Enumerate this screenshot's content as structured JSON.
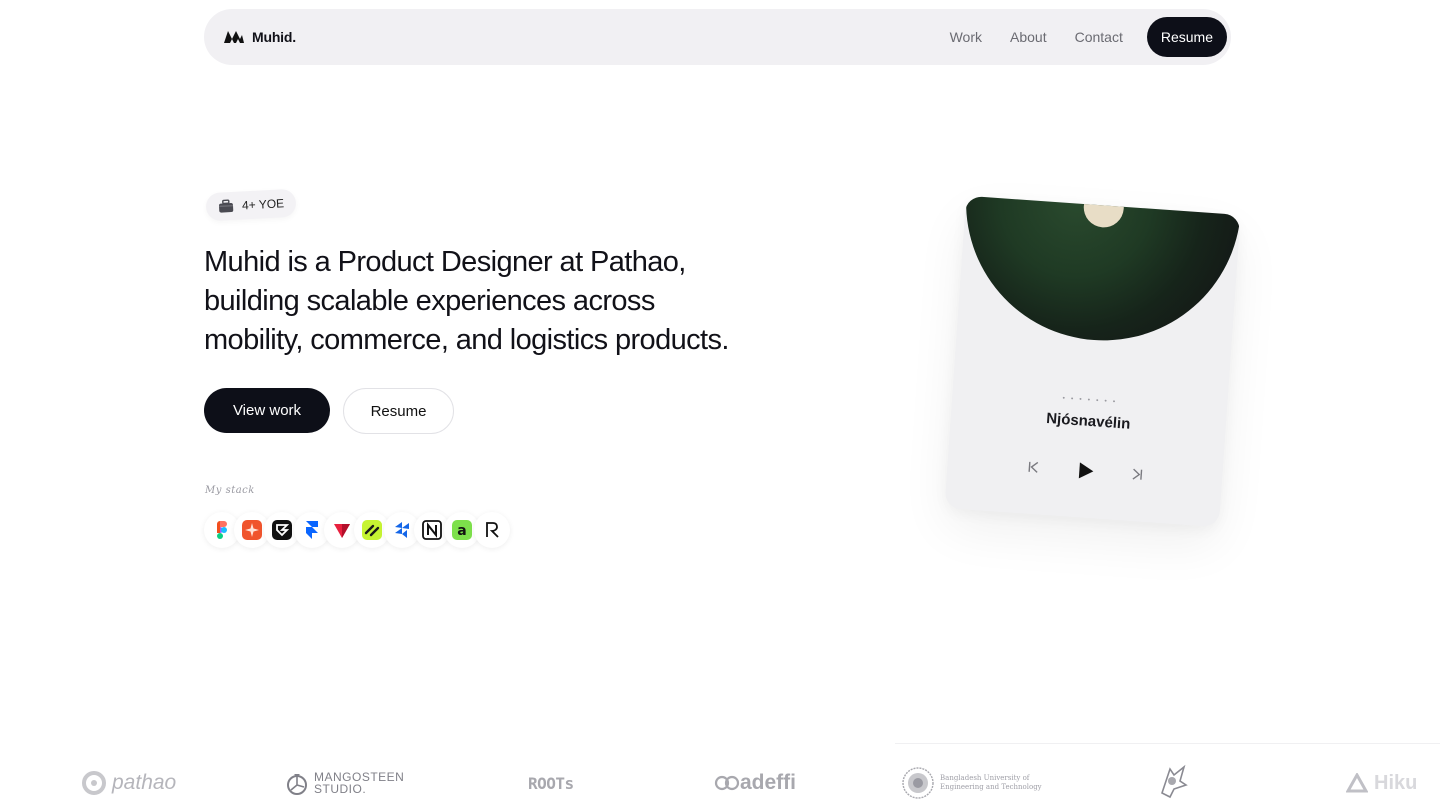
{
  "nav": {
    "brand": "Muhid.",
    "links": [
      "Work",
      "About",
      "Contact"
    ],
    "resume": "Resume"
  },
  "hero": {
    "badge": "4+ YOE",
    "headline_lines": [
      "Muhid is a Product Designer at Pathao,",
      "building scalable experiences across",
      "mobility, commerce, and logistics products."
    ],
    "primary_cta": "View work",
    "secondary_cta": "Resume",
    "stack_label": "My stack",
    "stack_icons": [
      "figma-icon",
      "craft-icon",
      "framer-dark-icon",
      "framer-icon",
      "protopie-icon",
      "linear-icon",
      "framer-motion-icon",
      "notion-icon",
      "arc-icon",
      "raycast-icon"
    ]
  },
  "player": {
    "dots": "• • • • • • •",
    "track": "Njósnavélin",
    "controls": [
      "previous-icon",
      "play-icon",
      "next-icon"
    ]
  },
  "logos": {
    "items": [
      "pathao",
      "MANGOSTEEN STUDIO.",
      "ROOTs",
      "adeffi",
      "Bangladesh University of Engineering and Technology",
      "AGS",
      "Hiku"
    ],
    "pathao": "pathao",
    "mangosteen_1": "MANGOSTEEN",
    "mangosteen_2": "STUDIO.",
    "roots": "ROOTs",
    "adeffi": "adeffi",
    "buet_1": "Bangladesh University of",
    "buet_2": "Engineering and Technology",
    "hiku": "Hiku"
  },
  "colors": {
    "accent_dark": "#0d0f18",
    "nav_bg": "#f1f0f3"
  }
}
